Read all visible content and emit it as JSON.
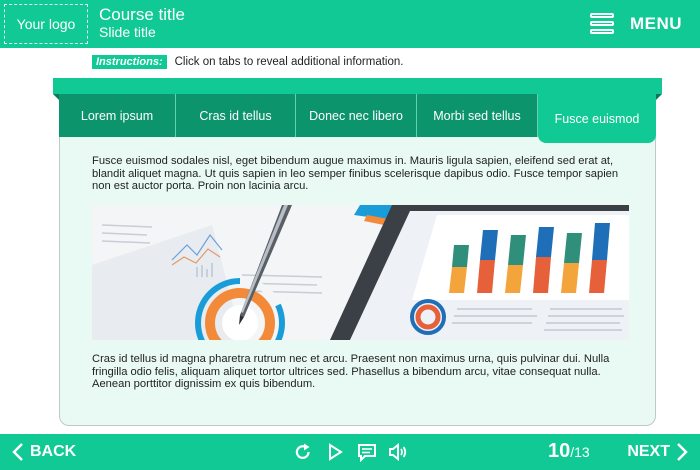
{
  "header": {
    "logo": "Your logo",
    "course_title": "Course title",
    "slide_title": "Slide title",
    "menu_label": "MENU",
    "menu_icon": "hamburger-menu-icon"
  },
  "instructions": {
    "label": "Instructions:",
    "text": "Click on tabs to reveal additional information."
  },
  "tabs": [
    {
      "label": "Lorem ipsum",
      "active": false
    },
    {
      "label": "Cras id tellus",
      "active": false
    },
    {
      "label": "Donec nec libero",
      "active": false
    },
    {
      "label": "Morbi sed tellus",
      "active": false
    },
    {
      "label": "Fusce euismod",
      "active": true
    }
  ],
  "content": {
    "paragraph1": "Fusce euismod sodales nisl, eget bibendum augue maximus in. Mauris ligula sapien, eleifend sed erat at, blandit aliquet magna. Ut quis sapien in leo semper finibus scelerisque dapibus odio. Fusce tempor sapien non est auctor porta. Proin non lacinia arcu.",
    "image": "business-charts-tablet-pen-photo",
    "paragraph2": "Cras id tellus id magna pharetra rutrum nec et arcu. Praesent non maximus urna, quis pulvinar dui. Nulla fringilla odio felis, aliquam aliquet tortor ultrices sed. Phasellus a bibendum arcu, vitae consequat nulla. Aenean porttitor dignissim ex quis bibendum."
  },
  "footer": {
    "back_label": "BACK",
    "next_label": "NEXT",
    "current_slide": "10",
    "total_slides": "/13",
    "controls": [
      "replay-icon",
      "play-icon",
      "subtitles-icon",
      "volume-icon"
    ]
  },
  "colors": {
    "accent": "#10c994",
    "tab_inactive": "#0c946d",
    "panel_bg": "#e9faf5"
  }
}
